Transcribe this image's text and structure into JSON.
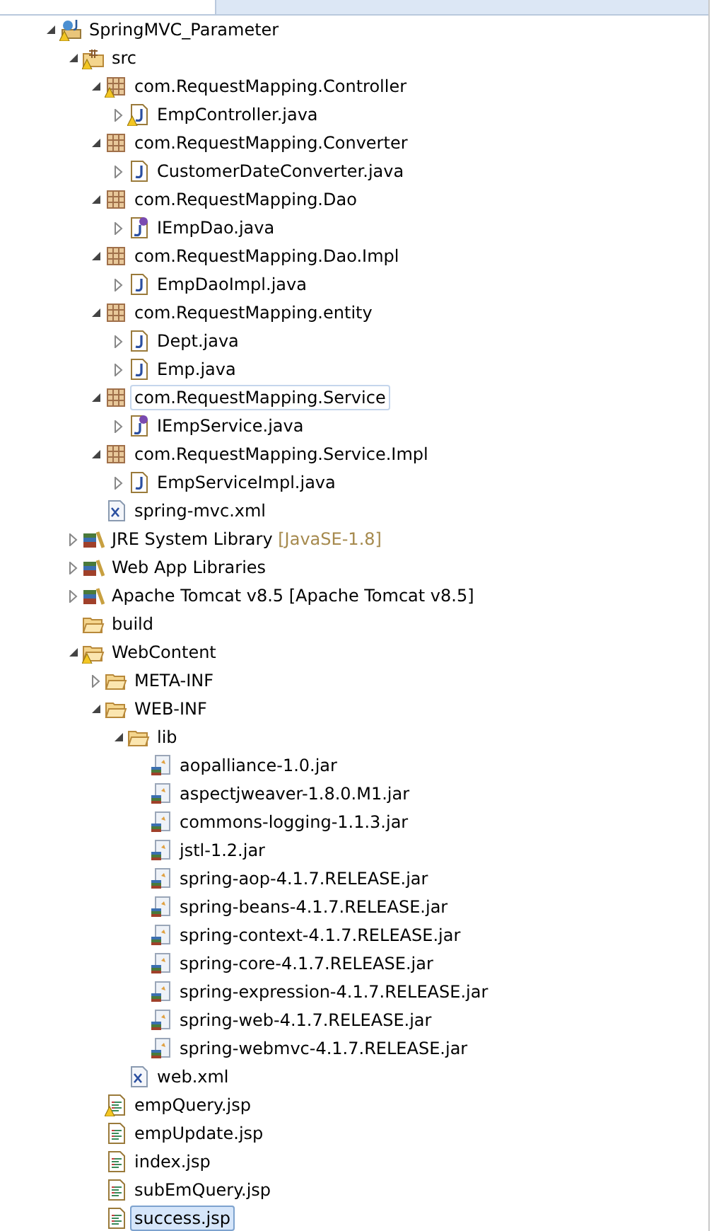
{
  "tree": [
    {
      "label": "SpringMVC_Parameter",
      "kind": "project",
      "expanded": true,
      "warning": true,
      "selected": false,
      "children": [
        {
          "label": "src",
          "kind": "source-folder",
          "expanded": true,
          "warning": true,
          "selected": false,
          "children": [
            {
              "label": "com.RequestMapping.Controller",
              "kind": "package",
              "expanded": true,
              "warning": true,
              "selected": false,
              "children": [
                {
                  "label": "EmpController.java",
                  "kind": "java",
                  "expanded": false,
                  "warning": true,
                  "selected": false
                }
              ]
            },
            {
              "label": "com.RequestMapping.Converter",
              "kind": "package",
              "expanded": true,
              "warning": false,
              "selected": false,
              "children": [
                {
                  "label": "CustomerDateConverter.java",
                  "kind": "java",
                  "expanded": false,
                  "warning": false,
                  "selected": false
                }
              ]
            },
            {
              "label": "com.RequestMapping.Dao",
              "kind": "package",
              "expanded": true,
              "warning": false,
              "selected": false,
              "children": [
                {
                  "label": "IEmpDao.java",
                  "kind": "interface",
                  "expanded": false,
                  "warning": false,
                  "selected": false
                }
              ]
            },
            {
              "label": "com.RequestMapping.Dao.Impl",
              "kind": "package",
              "expanded": true,
              "warning": false,
              "selected": false,
              "children": [
                {
                  "label": "EmpDaoImpl.java",
                  "kind": "java",
                  "expanded": false,
                  "warning": false,
                  "selected": false
                }
              ]
            },
            {
              "label": "com.RequestMapping.entity",
              "kind": "package",
              "expanded": true,
              "warning": false,
              "selected": false,
              "children": [
                {
                  "label": "Dept.java",
                  "kind": "java",
                  "expanded": false,
                  "warning": false,
                  "selected": false
                },
                {
                  "label": "Emp.java",
                  "kind": "java",
                  "expanded": false,
                  "warning": false,
                  "selected": false
                }
              ]
            },
            {
              "label": "com.RequestMapping.Service",
              "kind": "package",
              "expanded": true,
              "warning": false,
              "selected": false,
              "focused": true,
              "children": [
                {
                  "label": "IEmpService.java",
                  "kind": "interface",
                  "expanded": false,
                  "warning": false,
                  "selected": false
                }
              ]
            },
            {
              "label": "com.RequestMapping.Service.Impl",
              "kind": "package",
              "expanded": true,
              "warning": false,
              "selected": false,
              "children": [
                {
                  "label": "EmpServiceImpl.java",
                  "kind": "java",
                  "expanded": false,
                  "warning": false,
                  "selected": false
                }
              ]
            },
            {
              "label": "spring-mvc.xml",
              "kind": "xml",
              "warning": false,
              "selected": false
            }
          ]
        },
        {
          "label": "JRE System Library",
          "decoration": "[JavaSE-1.8]",
          "kind": "library",
          "expanded": false,
          "warning": false,
          "selected": false
        },
        {
          "label": "Web App Libraries",
          "kind": "library",
          "expanded": false,
          "warning": false,
          "selected": false
        },
        {
          "label": "Apache Tomcat v8.5 [Apache Tomcat v8.5]",
          "kind": "library",
          "expanded": false,
          "warning": false,
          "selected": false
        },
        {
          "label": "build",
          "kind": "folder",
          "warning": false,
          "selected": false
        },
        {
          "label": "WebContent",
          "kind": "folder",
          "expanded": true,
          "warning": true,
          "selected": false,
          "children": [
            {
              "label": "META-INF",
              "kind": "folder",
              "expanded": false,
              "warning": false,
              "selected": false
            },
            {
              "label": "WEB-INF",
              "kind": "folder",
              "expanded": true,
              "warning": false,
              "selected": false,
              "children": [
                {
                  "label": "lib",
                  "kind": "folder",
                  "expanded": true,
                  "warning": false,
                  "selected": false,
                  "children": [
                    {
                      "label": "aopalliance-1.0.jar",
                      "kind": "jar",
                      "warning": false,
                      "selected": false
                    },
                    {
                      "label": "aspectjweaver-1.8.0.M1.jar",
                      "kind": "jar",
                      "warning": false,
                      "selected": false
                    },
                    {
                      "label": "commons-logging-1.1.3.jar",
                      "kind": "jar",
                      "warning": false,
                      "selected": false
                    },
                    {
                      "label": "jstl-1.2.jar",
                      "kind": "jar",
                      "warning": false,
                      "selected": false
                    },
                    {
                      "label": "spring-aop-4.1.7.RELEASE.jar",
                      "kind": "jar",
                      "warning": false,
                      "selected": false
                    },
                    {
                      "label": "spring-beans-4.1.7.RELEASE.jar",
                      "kind": "jar",
                      "warning": false,
                      "selected": false
                    },
                    {
                      "label": "spring-context-4.1.7.RELEASE.jar",
                      "kind": "jar",
                      "warning": false,
                      "selected": false
                    },
                    {
                      "label": "spring-core-4.1.7.RELEASE.jar",
                      "kind": "jar",
                      "warning": false,
                      "selected": false
                    },
                    {
                      "label": "spring-expression-4.1.7.RELEASE.jar",
                      "kind": "jar",
                      "warning": false,
                      "selected": false
                    },
                    {
                      "label": "spring-web-4.1.7.RELEASE.jar",
                      "kind": "jar",
                      "warning": false,
                      "selected": false
                    },
                    {
                      "label": "spring-webmvc-4.1.7.RELEASE.jar",
                      "kind": "jar",
                      "warning": false,
                      "selected": false
                    }
                  ]
                },
                {
                  "label": "web.xml",
                  "kind": "xml",
                  "warning": false,
                  "selected": false
                }
              ]
            },
            {
              "label": "empQuery.jsp",
              "kind": "jsp",
              "warning": true,
              "selected": false
            },
            {
              "label": "empUpdate.jsp",
              "kind": "jsp",
              "warning": false,
              "selected": false
            },
            {
              "label": "index.jsp",
              "kind": "jsp",
              "warning": false,
              "selected": false
            },
            {
              "label": "subEmQuery.jsp",
              "kind": "jsp",
              "warning": false,
              "selected": false
            },
            {
              "label": "success.jsp",
              "kind": "jsp",
              "warning": false,
              "selected": true
            }
          ]
        }
      ]
    }
  ]
}
